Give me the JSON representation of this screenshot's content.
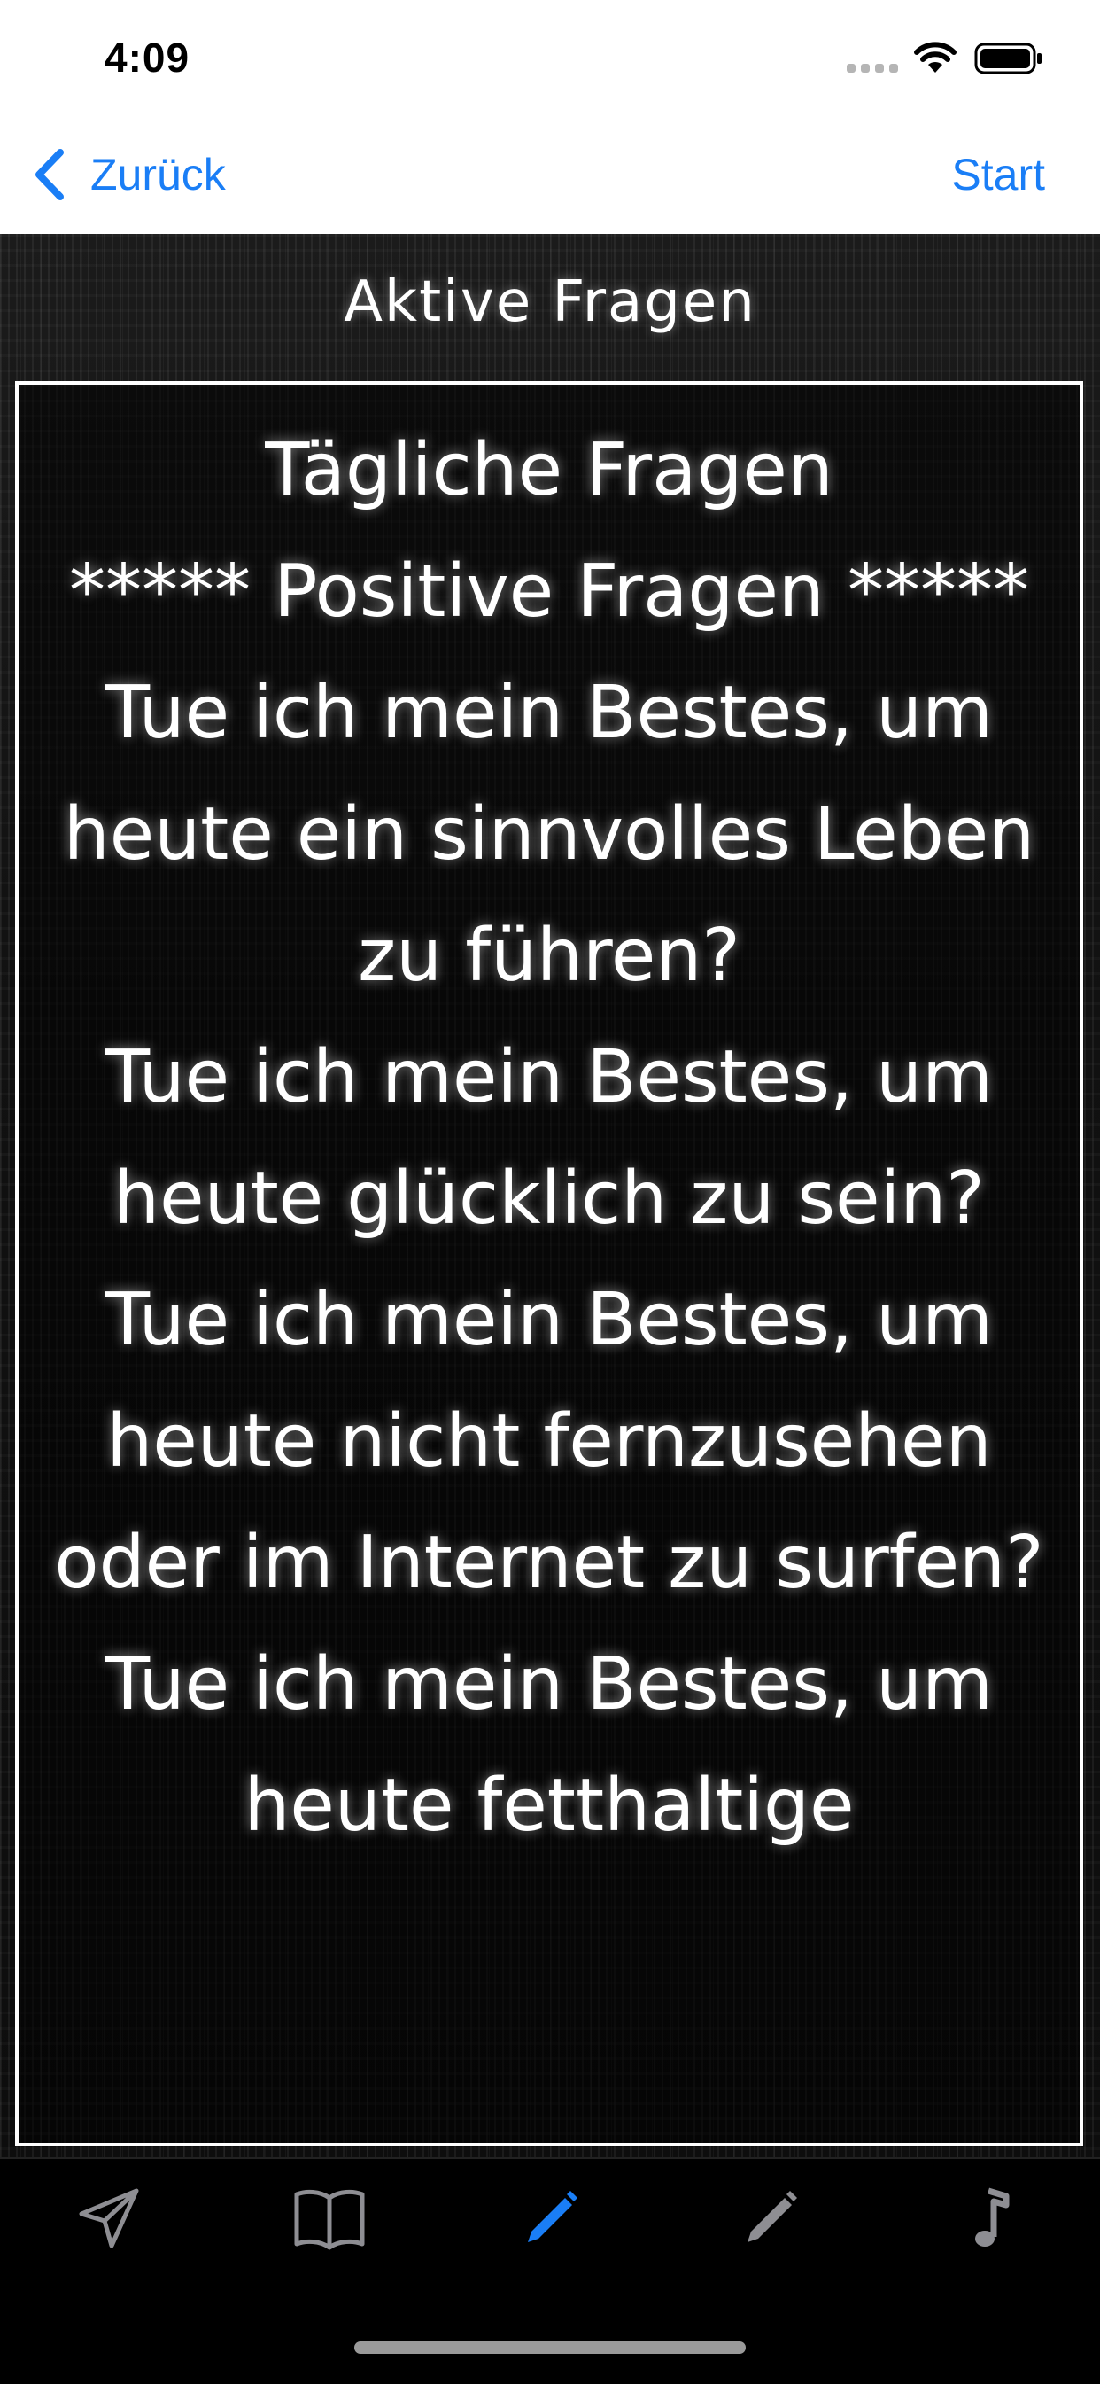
{
  "status_bar": {
    "time": "4:09",
    "icons": [
      "signal-icon",
      "wifi-icon",
      "battery-icon"
    ]
  },
  "nav_bar": {
    "back_label": "Zurück",
    "right_action": "Start",
    "accent_color": "#1a7ef6"
  },
  "content": {
    "title": "Aktive Fragen",
    "lines": [
      "Tägliche Fragen",
      "***** Positive Fragen *****",
      "Tue ich mein Bestes, um heute ein sinnvolles Leben zu führen?",
      "Tue ich mein Bestes, um heute glücklich zu sein?",
      "Tue ich mein Bestes, um heute nicht fernzusehen oder im Internet zu surfen?",
      "Tue ich mein Bestes, um heute fetthaltige"
    ]
  },
  "tab_bar": {
    "items": [
      {
        "icon": "paper-plane-icon",
        "active": false
      },
      {
        "icon": "book-icon",
        "active": false
      },
      {
        "icon": "pencil-icon",
        "active": true
      },
      {
        "icon": "pencil-icon",
        "active": false
      },
      {
        "icon": "music-note-icon",
        "active": false
      }
    ],
    "active_color": "#1a7ef6",
    "inactive_color": "#8e8e93"
  }
}
